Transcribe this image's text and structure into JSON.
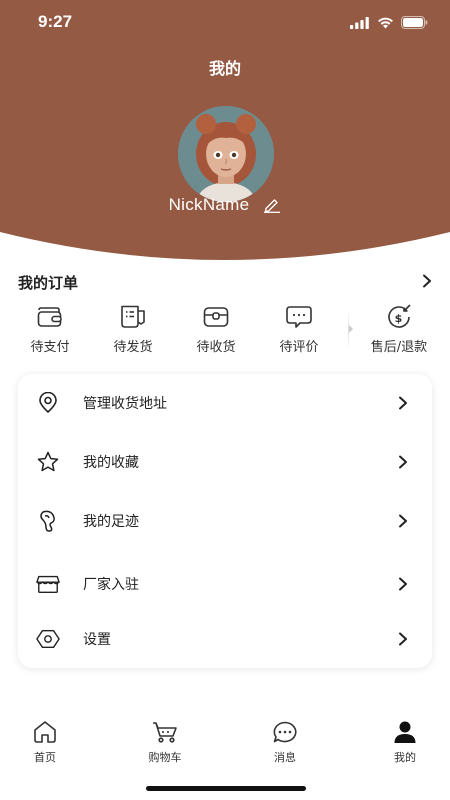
{
  "status_bar": {
    "time": "9:27"
  },
  "header": {
    "title": "我的",
    "nickname": "NickName",
    "background_color": "#945a43"
  },
  "orders": {
    "title": "我的订单",
    "items": [
      {
        "label": "待支付",
        "icon": "wallet-icon"
      },
      {
        "label": "待发货",
        "icon": "receipt-icon"
      },
      {
        "label": "待收货",
        "icon": "package-icon"
      },
      {
        "label": "待评价",
        "icon": "chat-bubble-icon"
      },
      {
        "label": "售后/退款",
        "icon": "refund-icon"
      }
    ]
  },
  "menu": [
    {
      "label": "管理收货地址",
      "icon": "location-pin-icon"
    },
    {
      "label": "我的收藏",
      "icon": "star-icon"
    },
    {
      "label": "我的足迹",
      "icon": "footprint-icon"
    },
    {
      "label": "厂家入驻",
      "icon": "storefront-icon"
    },
    {
      "label": "设置",
      "icon": "settings-hexagon-icon"
    }
  ],
  "tab_bar": [
    {
      "label": "首页",
      "icon": "home-icon"
    },
    {
      "label": "购物车",
      "icon": "cart-icon"
    },
    {
      "label": "消息",
      "icon": "message-icon"
    },
    {
      "label": "我的",
      "icon": "profile-icon",
      "active": true
    }
  ]
}
